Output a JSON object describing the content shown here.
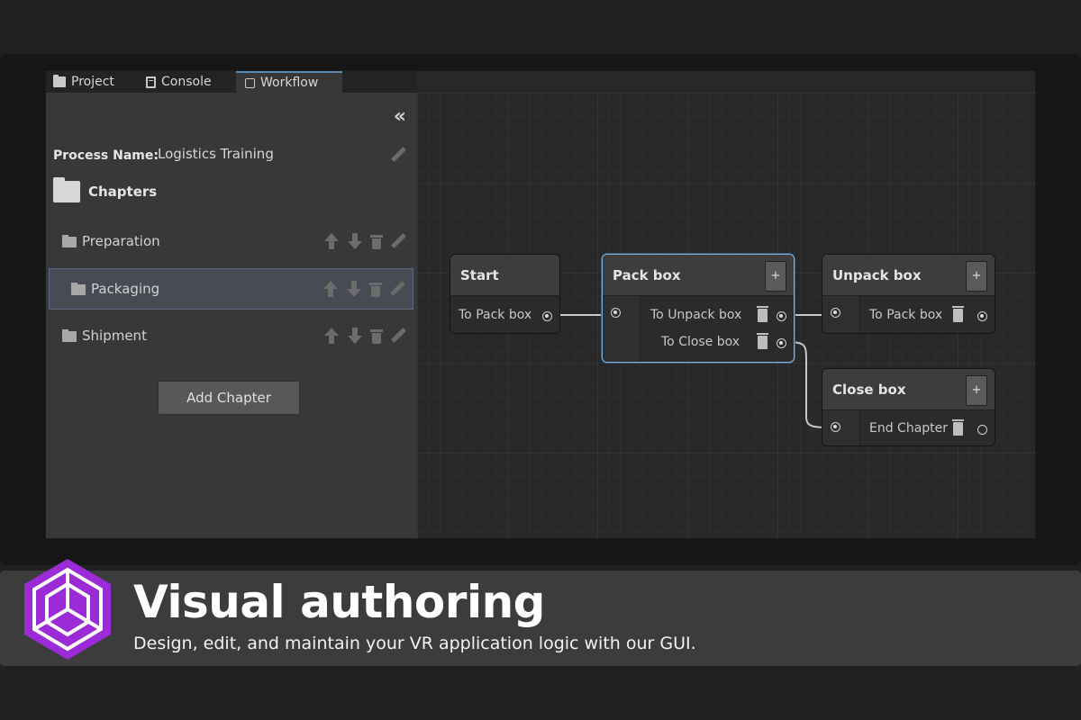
{
  "tabs": [
    {
      "label": "Project",
      "icon": "folder-icon"
    },
    {
      "label": "Console",
      "icon": "console-icon"
    },
    {
      "label": "Workflow",
      "icon": "workflow-icon",
      "active": true
    }
  ],
  "panel": {
    "collapse_glyph": "‹‹",
    "process_name_label": "Process Name:",
    "process_name_value": "Logistics Training",
    "chapters_label": "Chapters",
    "chapters": [
      {
        "label": "Preparation",
        "selected": false
      },
      {
        "label": "Packaging",
        "selected": true
      },
      {
        "label": "Shipment",
        "selected": false
      }
    ],
    "add_chapter_label": "Add Chapter"
  },
  "graph": {
    "nodes": {
      "start": {
        "title": "Start",
        "transitions": [
          "To Pack box"
        ]
      },
      "pack": {
        "title": "Pack box",
        "plus": "+",
        "transitions": [
          "To Unpack box",
          "To Close box"
        ]
      },
      "unpack": {
        "title": "Unpack box",
        "plus": "+",
        "transitions": [
          "To Pack box"
        ]
      },
      "close": {
        "title": "Close box",
        "plus": "+",
        "transitions": [
          "End Chapter"
        ]
      }
    }
  },
  "banner": {
    "title": "Visual authoring",
    "subtitle": "Design, edit, and maintain your VR application logic with our GUI.",
    "logo_color": "#9b2bd6"
  },
  "colors": {
    "selection_border": "#7ab3e0",
    "tab_accent": "#5a8bb6"
  }
}
